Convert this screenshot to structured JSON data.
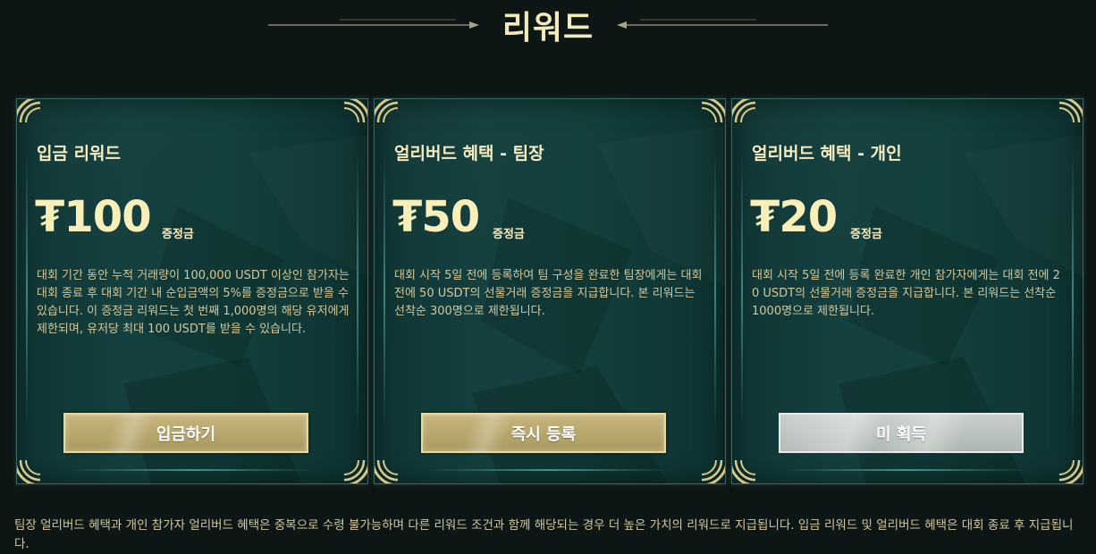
{
  "page": {
    "title": "리워드",
    "footnote": "팀장 얼리버드 혜택과 개인 참가자 얼리버드 혜택은 중복으로 수령 불가능하며 다른 리워드 조건과 함께 해당되는 경우 더 높은 가치의 리워드로 지급됩니다. 입금 리워드 및 얼리버드 혜택은 대회 종료 후 지급됩니다."
  },
  "cards": [
    {
      "title": "입금 리워드",
      "amount": "₮100",
      "amount_label": "증정금",
      "description": "대회 기간 동안 누적 거래량이 100,000 USDT 이상인 참가자는 대회 종료 후 대회 기간 내 순입금액의 5%를 증정금으로 받을 수 있습니다. 이 증정금 리워드는 첫 번째 1,000명의 해당 유저에게 제한되며, 유저당 최대 100 USDT를 받을 수 있습니다.",
      "button": "입금하기",
      "button_style": "gold"
    },
    {
      "title": "얼리버드 혜택 - 팀장",
      "amount": "₮50",
      "amount_label": "증정금",
      "description": "대회 시작 5일 전에 등록하여 팀 구성을 완료한 팀장에게는 대회 전에 50 USDT의 선물거래 증정금을 지급합니다. 본 리워드는 선착순 300명으로 제한됩니다.",
      "button": "즉시 등록",
      "button_style": "gold"
    },
    {
      "title": "얼리버드 혜택 - 개인",
      "amount": "₮20",
      "amount_label": "증정금",
      "description": "대회 시작 5일 전에 등록 완료한 개인 참가자에게는 대회 전에 20 USDT의 선물거래 증정금을 지급합니다. 본 리워드는 선착순 1000명으로 제한됩니다.",
      "button": "미 획득",
      "button_style": "silver"
    }
  ],
  "colors": {
    "accent_gold": "#f4e9b8",
    "text_body": "#d4c79a",
    "card_bg": "#13403e",
    "button_gold": "#b8a86e",
    "button_silver": "#bcc3c0"
  },
  "icons": [
    "corner-ornament-icon",
    "arrow-left-icon",
    "arrow-right-icon"
  ]
}
